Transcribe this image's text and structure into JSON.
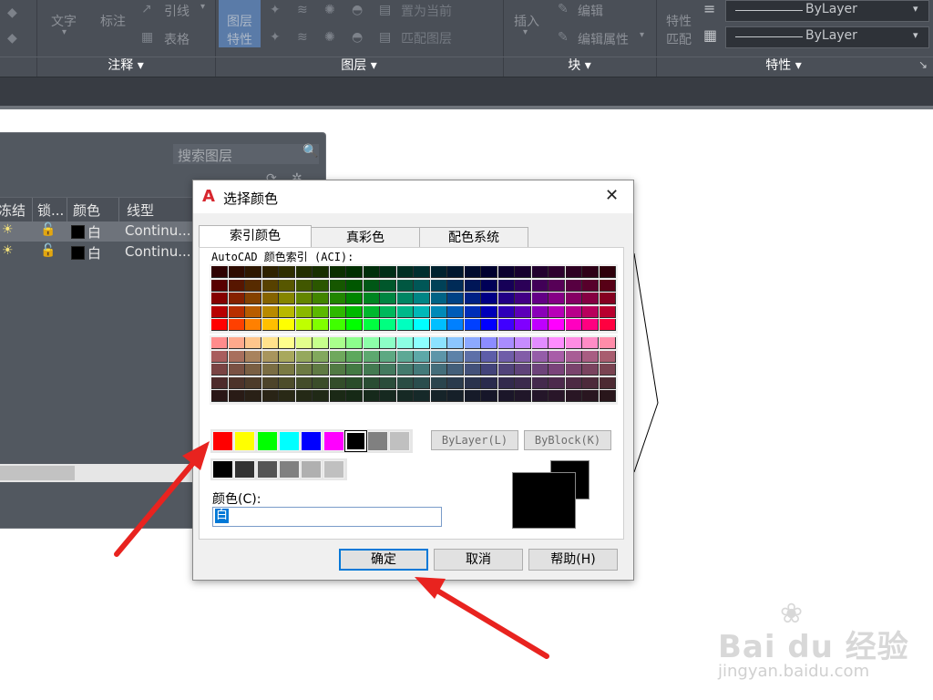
{
  "ribbon": {
    "text_label": "文字",
    "dim_label": "标注",
    "leader_label": "引线",
    "table_label": "表格",
    "layer_props_label_1": "图层",
    "layer_props_label_2": "特性",
    "set_current_label": "置为当前",
    "match_layer_label": "匹配图层",
    "insert_label": "插入",
    "edit_label": "编辑",
    "edit_attr_label": "编辑属性",
    "props_label": "特性",
    "match_label": "匹配",
    "bylayer_1": "ByLayer",
    "bylayer_2": "ByLayer",
    "panel_annotation": "注释",
    "panel_layers": "图层",
    "panel_block": "块",
    "panel_properties": "特性"
  },
  "layer_palette": {
    "search_placeholder": "搜索图层",
    "columns": [
      "冻结",
      "锁...",
      "颜色",
      "线型"
    ],
    "rows": [
      {
        "color_name": "白",
        "linetype": "Continu..."
      },
      {
        "color_name": "白",
        "linetype": "Continu..."
      }
    ]
  },
  "dialog": {
    "title": "选择颜色",
    "tabs": [
      "索引颜色",
      "真彩色",
      "配色系统"
    ],
    "aci_label": "AutoCAD 颜色索引 (ACI):",
    "bylayer_button": "ByLayer(L)",
    "byblock_button": "ByBlock(K)",
    "color_label": "颜色(C):",
    "color_value": "白",
    "ok": "确定",
    "cancel": "取消",
    "help": "帮助(H)",
    "standard_colors": [
      "#ff0000",
      "#ffff00",
      "#00ff00",
      "#00ffff",
      "#0000ff",
      "#ff00ff",
      "#000000",
      "#808080",
      "#c0c0c0"
    ],
    "gray_colors": [
      "#000000",
      "#333333",
      "#555555",
      "#808080",
      "#b0b0b0",
      "#c0c0c0"
    ],
    "selected_color": "#000000"
  },
  "watermark": {
    "brand": "Bai du 经验",
    "url": "jingyan.baidu.com"
  }
}
